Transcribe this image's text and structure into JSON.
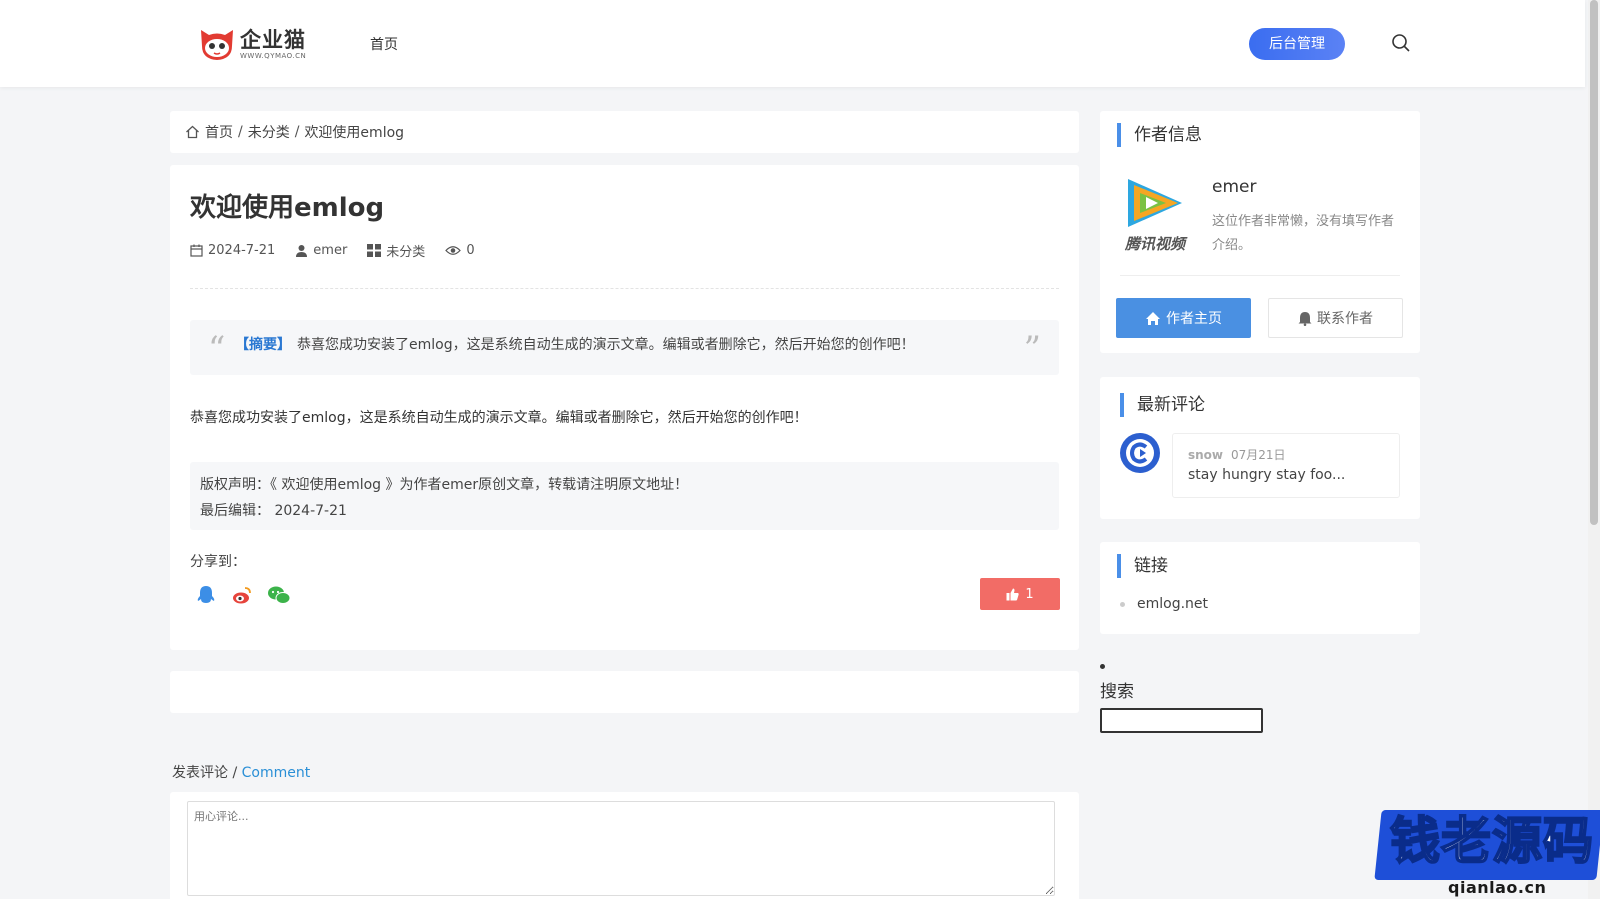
{
  "header": {
    "logo_text": "企业猫",
    "logo_sub": "WWW.QYMAO.CN",
    "nav_home": "首页",
    "admin_label": "后台管理"
  },
  "breadcrumb": {
    "home": "首页",
    "category": "未分类",
    "current": "欢迎使用emlog",
    "sep": "/"
  },
  "article": {
    "title": "欢迎使用emlog",
    "date": "2024-7-21",
    "author": "emer",
    "category": "未分类",
    "views": "0",
    "summary_tag": "【摘要】",
    "summary_text": "恭喜您成功安装了emlog，这是系统自动生成的演示文章。编辑或者删除它，然后开始您的创作吧！",
    "body": "恭喜您成功安装了emlog，这是系统自动生成的演示文章。编辑或者删除它，然后开始您的创作吧！",
    "copyright_line": "版权声明：《 欢迎使用emlog 》为作者emer原创文章，转载请注明原文地址！",
    "last_edit_label": "最后编辑：",
    "last_edit_date": "2024-7-21",
    "share_label": "分享到：",
    "likes": "1"
  },
  "comment_form": {
    "heading_cn": "发表评论",
    "heading_sep": " / ",
    "heading_en": "Comment",
    "placeholder": "用心评论..."
  },
  "sidebar": {
    "author_title": "作者信息",
    "author_name": "emer",
    "author_desc": "这位作者非常懒，没有填写作者介绍。",
    "avatar_caption": "腾讯视频",
    "author_home": "作者主页",
    "author_contact": "联系作者",
    "comments_title": "最新评论",
    "comment_user": "snow",
    "comment_date": "07月21日",
    "comment_text": "stay hungry stay foo...",
    "links_title": "链接",
    "link_1": "emlog.net",
    "search_title": "搜索"
  },
  "watermark": {
    "text": "钱老源码",
    "sub": "qianlao.cn"
  },
  "colors": {
    "accent": "#4a90e2",
    "admin_btn": "#3a6df0",
    "like_btn": "#f26c66",
    "summary_tag": "#2a78d2"
  }
}
